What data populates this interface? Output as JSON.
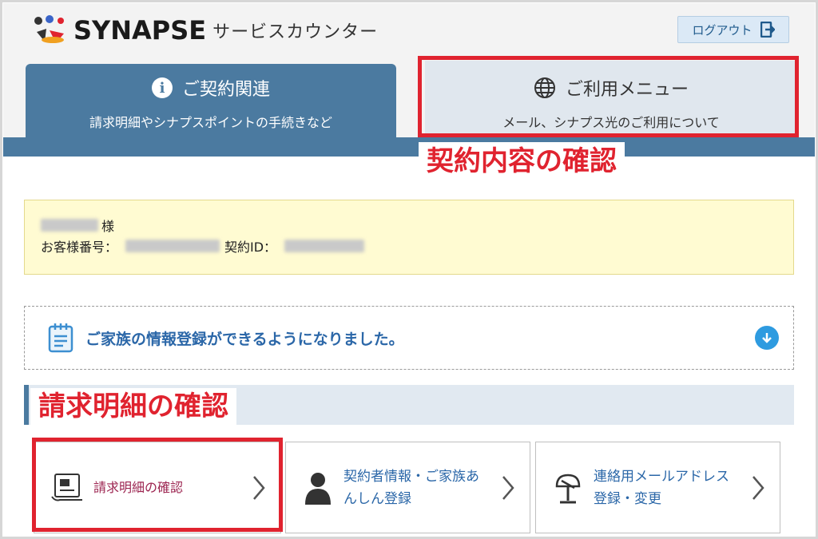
{
  "header": {
    "brand": "SYNAPSE",
    "service_name": "サービスカウンター",
    "logout_label": "ログアウト"
  },
  "tabs": [
    {
      "title": "ご契約関連",
      "subtitle": "請求明細やシナプスポイントの手続きなど",
      "icon": "info-icon",
      "active": true
    },
    {
      "title": "ご利用メニュー",
      "subtitle": "メール、シナプス光のご利用について",
      "icon": "globe-icon",
      "active": false
    }
  ],
  "annotations": {
    "contract_label": "契約内容の確認",
    "billing_label": "請求明細の確認",
    "color": "#e0232f"
  },
  "customer": {
    "honorific": "様",
    "customer_number_label": "お客様番号：",
    "contract_id_label": "契約ID："
  },
  "notice": {
    "text": "ご家族の情報登録ができるようになりました。"
  },
  "cards": [
    {
      "label": "請求明細の確認",
      "icon": "document-icon"
    },
    {
      "label_line1": "契約者情報・ご家族あ",
      "label_line2": "んしん登録",
      "icon": "person-icon"
    },
    {
      "label_line1": "連絡用メールアドレス",
      "label_line2": "登録・変更",
      "icon": "mailbox-icon"
    }
  ],
  "colors": {
    "accent": "#4b7aa0",
    "link": "#2b67a8",
    "notice_bg": "#fffbd2"
  }
}
